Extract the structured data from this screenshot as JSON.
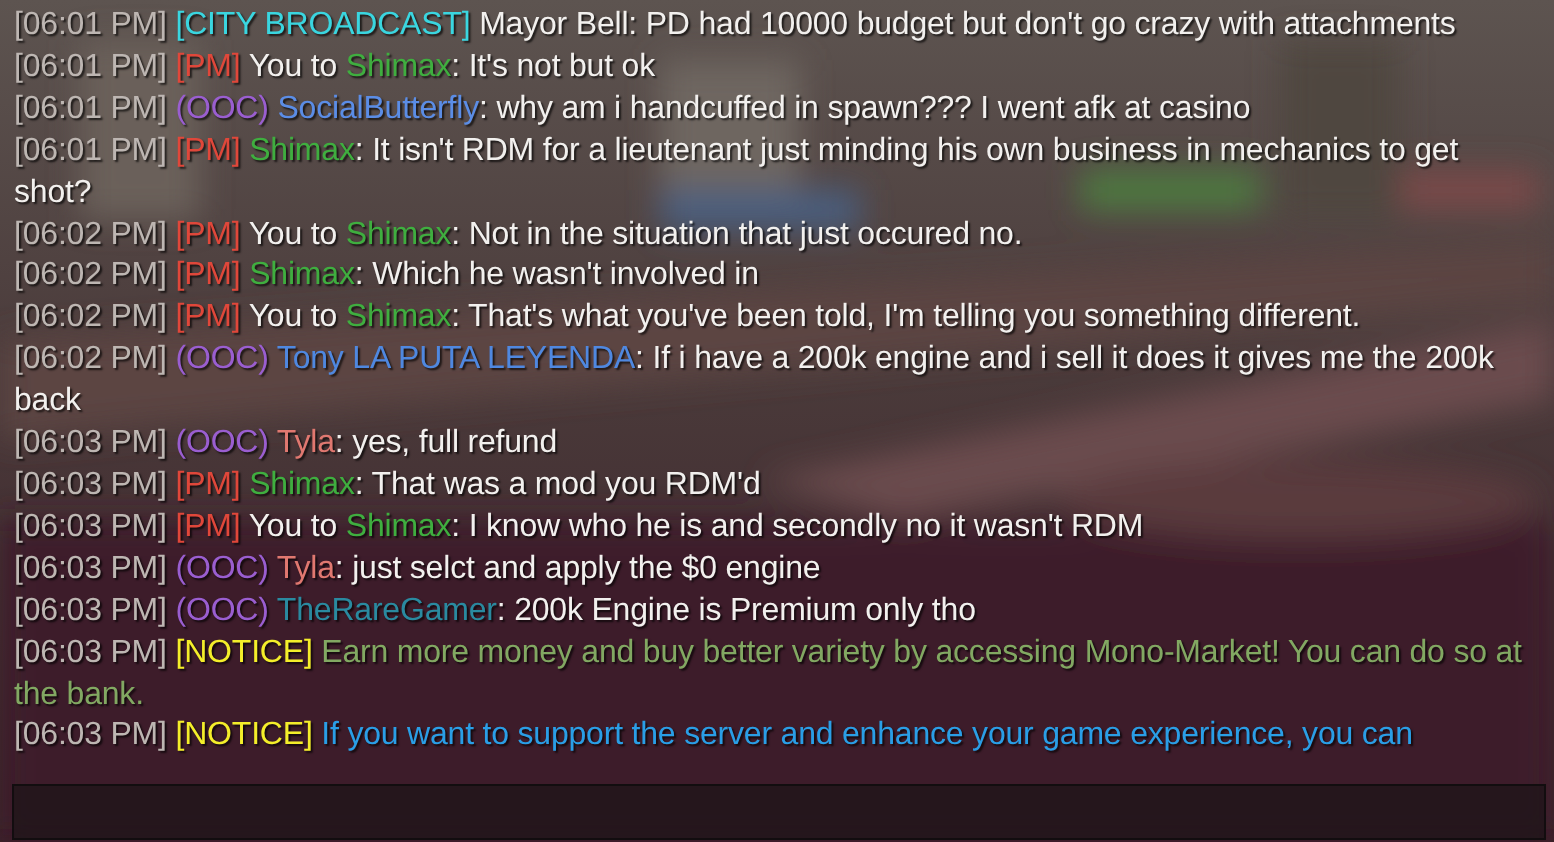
{
  "messages": [
    {
      "time": "[06:01 PM]",
      "kind": "city",
      "tag": "[CITY BROADCAST]",
      "sender": "Mayor Bell",
      "text": ": PD had 10000 budget but don't go crazy with attachments"
    },
    {
      "time": "[06:01 PM]",
      "kind": "pm",
      "tag": "[PM]",
      "prefix": "You to",
      "sender": "Shimax",
      "color": "#3fae3f",
      "text": ": It's not but ok"
    },
    {
      "time": "[06:01 PM]",
      "kind": "ooc",
      "tag": "(OOC)",
      "sender": "SocialButterfly",
      "color": "#5b8de6",
      "text": ": why am i handcuffed in spawn??? I went afk at casino"
    },
    {
      "time": "[06:01 PM]",
      "kind": "pm",
      "tag": "[PM]",
      "sender": "Shimax",
      "color": "#3fae3f",
      "text": ": It isn't RDM for a lieutenant just minding his own business in mechanics to get shot?"
    },
    {
      "time": "[06:02 PM]",
      "kind": "pm",
      "tag": "[PM]",
      "prefix": "You to",
      "sender": "Shimax",
      "color": "#3fae3f",
      "text": ": Not in the situation that just occured no."
    },
    {
      "time": "[06:02 PM]",
      "kind": "pm",
      "tag": "[PM]",
      "sender": "Shimax",
      "color": "#3fae3f",
      "text": ": Which he wasn't involved in"
    },
    {
      "time": "[06:02 PM]",
      "kind": "pm",
      "tag": "[PM]",
      "prefix": "You to",
      "sender": "Shimax",
      "color": "#3fae3f",
      "text": ": That's what you've been told, I'm telling you something different."
    },
    {
      "time": "[06:02 PM]",
      "kind": "ooc",
      "tag": "(OOC)",
      "sender": "Tony LA PUTA LEYENDA",
      "color": "#4f88e0",
      "text": ": If i have a 200k engine and i sell it does it gives me the 200k back"
    },
    {
      "time": "[06:03 PM]",
      "kind": "ooc",
      "tag": "(OOC)",
      "sender": "Tyla",
      "color": "#e07870",
      "text": ": yes, full refund"
    },
    {
      "time": "[06:03 PM]",
      "kind": "pm",
      "tag": "[PM]",
      "sender": "Shimax",
      "color": "#3fae3f",
      "text": ": That was a mod you RDM'd"
    },
    {
      "time": "[06:03 PM]",
      "kind": "pm",
      "tag": "[PM]",
      "prefix": "You to",
      "sender": "Shimax",
      "color": "#3fae3f",
      "text": ": I know who he is and secondly no it wasn't RDM"
    },
    {
      "time": "[06:03 PM]",
      "kind": "ooc",
      "tag": "(OOC)",
      "sender": "Tyla",
      "color": "#e07870",
      "text": ": just selct and apply the $0 engine"
    },
    {
      "time": "[06:03 PM]",
      "kind": "ooc",
      "tag": "(OOC)",
      "sender": "TheRareGamer",
      "color": "#2a8aa0",
      "text": ": 200k Engine is Premium only tho"
    },
    {
      "time": "[06:03 PM]",
      "kind": "notice",
      "tag": "[NOTICE]",
      "color": "#82a862",
      "text": "Earn more money and buy better variety by accessing Mono-Market! You can do so at the bank."
    },
    {
      "time": "[06:03 PM]",
      "kind": "notice",
      "tag": "[NOTICE]",
      "color": "#2a9ee6",
      "text": "If you want to support the server and enhance your game experience, you can"
    }
  ]
}
